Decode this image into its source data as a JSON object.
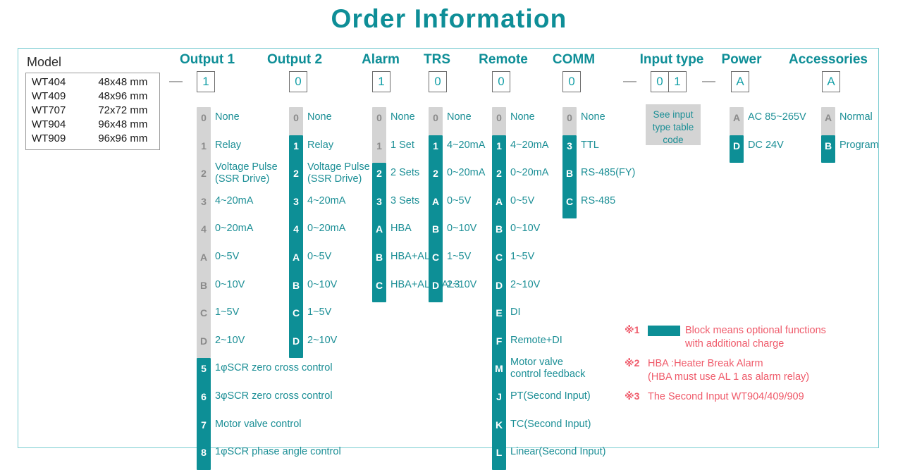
{
  "title": "Order Information",
  "model": {
    "heading": "Model",
    "rows": [
      {
        "code": "WT404",
        "size": "48x48 mm"
      },
      {
        "code": "WT409",
        "size": "48x96 mm"
      },
      {
        "code": "WT707",
        "size": "72x72 mm"
      },
      {
        "code": "WT904",
        "size": "96x48 mm"
      },
      {
        "code": "WT909",
        "size": "96x96 mm"
      }
    ]
  },
  "separators": {
    "dash1": "—",
    "dash2": "—",
    "dash3": "—"
  },
  "groups": [
    {
      "name": "output1",
      "label": "Output 1",
      "selected": "1",
      "options": [
        {
          "code": "0",
          "text": "None",
          "teal": false
        },
        {
          "code": "1",
          "text": "Relay",
          "teal": false
        },
        {
          "code": "2",
          "text": "Voltage Pulse|(SSR Drive)",
          "teal": false
        },
        {
          "code": "3",
          "text": "4~20mA",
          "teal": false
        },
        {
          "code": "4",
          "text": "0~20mA",
          "teal": false
        },
        {
          "code": "A",
          "text": "0~5V",
          "teal": false
        },
        {
          "code": "B",
          "text": "0~10V",
          "teal": false
        },
        {
          "code": "C",
          "text": "1~5V",
          "teal": false
        },
        {
          "code": "D",
          "text": "2~10V",
          "teal": false
        },
        {
          "code": "5",
          "text": "1φSCR zero cross control",
          "teal": true
        },
        {
          "code": "6",
          "text": "3φSCR zero cross control",
          "teal": true
        },
        {
          "code": "7",
          "text": "Motor valve control",
          "teal": true
        },
        {
          "code": "8",
          "text": "1φSCR phase angle control",
          "teal": true
        }
      ]
    },
    {
      "name": "output2",
      "label": "Output 2",
      "selected": "0",
      "options": [
        {
          "code": "0",
          "text": "None",
          "teal": false
        },
        {
          "code": "1",
          "text": "Relay",
          "teal": true
        },
        {
          "code": "2",
          "text": "Voltage Pulse|(SSR Drive)",
          "teal": true
        },
        {
          "code": "3",
          "text": "4~20mA",
          "teal": true
        },
        {
          "code": "4",
          "text": "0~20mA",
          "teal": true
        },
        {
          "code": "A",
          "text": "0~5V",
          "teal": true
        },
        {
          "code": "B",
          "text": "0~10V",
          "teal": true
        },
        {
          "code": "C",
          "text": "1~5V",
          "teal": true
        },
        {
          "code": "D",
          "text": "2~10V",
          "teal": true
        }
      ]
    },
    {
      "name": "alarm",
      "label": "Alarm",
      "selected": "1",
      "options": [
        {
          "code": "0",
          "text": "None",
          "teal": false
        },
        {
          "code": "1",
          "text": "1 Set",
          "teal": false
        },
        {
          "code": "2",
          "text": "2 Sets",
          "teal": true
        },
        {
          "code": "3",
          "text": "3 Sets",
          "teal": true
        },
        {
          "code": "A",
          "text": "HBA",
          "teal": true
        },
        {
          "code": "B",
          "text": "HBA+AL2",
          "teal": true
        },
        {
          "code": "C",
          "text": "HBA+AL2+AL3",
          "teal": true
        }
      ]
    },
    {
      "name": "trs",
      "label": "TRS",
      "selected": "0",
      "options": [
        {
          "code": "0",
          "text": "None",
          "teal": false
        },
        {
          "code": "1",
          "text": "4~20mA",
          "teal": true
        },
        {
          "code": "2",
          "text": "0~20mA",
          "teal": true
        },
        {
          "code": "A",
          "text": "0~5V",
          "teal": true
        },
        {
          "code": "B",
          "text": "0~10V",
          "teal": true
        },
        {
          "code": "C",
          "text": "1~5V",
          "teal": true
        },
        {
          "code": "D",
          "text": "2~10V",
          "teal": true
        }
      ]
    },
    {
      "name": "remote",
      "label": "Remote",
      "selected": "0",
      "options": [
        {
          "code": "0",
          "text": "None",
          "teal": false
        },
        {
          "code": "1",
          "text": "4~20mA",
          "teal": true
        },
        {
          "code": "2",
          "text": "0~20mA",
          "teal": true
        },
        {
          "code": "A",
          "text": "0~5V",
          "teal": true
        },
        {
          "code": "B",
          "text": "0~10V",
          "teal": true
        },
        {
          "code": "C",
          "text": "1~5V",
          "teal": true
        },
        {
          "code": "D",
          "text": "2~10V",
          "teal": true
        },
        {
          "code": "E",
          "text": "DI",
          "teal": true
        },
        {
          "code": "F",
          "text": "Remote+DI",
          "teal": true
        },
        {
          "code": "M",
          "text": "Motor valve|control feedback",
          "teal": true
        },
        {
          "code": "J",
          "text": "PT(Second Input)",
          "teal": true
        },
        {
          "code": "K",
          "text": "TC(Second Input)",
          "teal": true
        },
        {
          "code": "L",
          "text": "Linear(Second Input)",
          "teal": true
        }
      ]
    },
    {
      "name": "comm",
      "label": "COMM",
      "selected": "0",
      "options": [
        {
          "code": "0",
          "text": "None",
          "teal": false
        },
        {
          "code": "3",
          "text": "TTL",
          "teal": true
        },
        {
          "code": "B",
          "text": "RS-485(FY)",
          "teal": true
        },
        {
          "code": "C",
          "text": "RS-485",
          "teal": true
        }
      ]
    },
    {
      "name": "input_type",
      "label": "Input type",
      "selected": "0",
      "selected2": "1",
      "note": "See input type table code",
      "options": []
    },
    {
      "name": "power",
      "label": "Power",
      "selected": "A",
      "options": [
        {
          "code": "A",
          "text": "AC 85~265V",
          "teal": false
        },
        {
          "code": "D",
          "text": "DC 24V",
          "teal": true
        }
      ]
    },
    {
      "name": "accessories",
      "label": "Accessories",
      "selected": "A",
      "options": [
        {
          "code": "A",
          "text": "Normal",
          "teal": false
        },
        {
          "code": "B",
          "text": "Program",
          "teal": true
        }
      ]
    }
  ],
  "notes": [
    {
      "mark": "※1",
      "text": "Block means optional functions|with additional charge",
      "swatch": true
    },
    {
      "mark": "※2",
      "text": "HBA :Heater Break Alarm|(HBA must use AL 1 as alarm relay)",
      "swatch": false
    },
    {
      "mark": "※3",
      "text": "The Second Input WT904/409/909",
      "swatch": false
    }
  ],
  "colors": {
    "teal": "#0d8f96",
    "gray": "#d4d4d4",
    "note_red": "#ef5a6a",
    "title": "#0e8e97"
  }
}
